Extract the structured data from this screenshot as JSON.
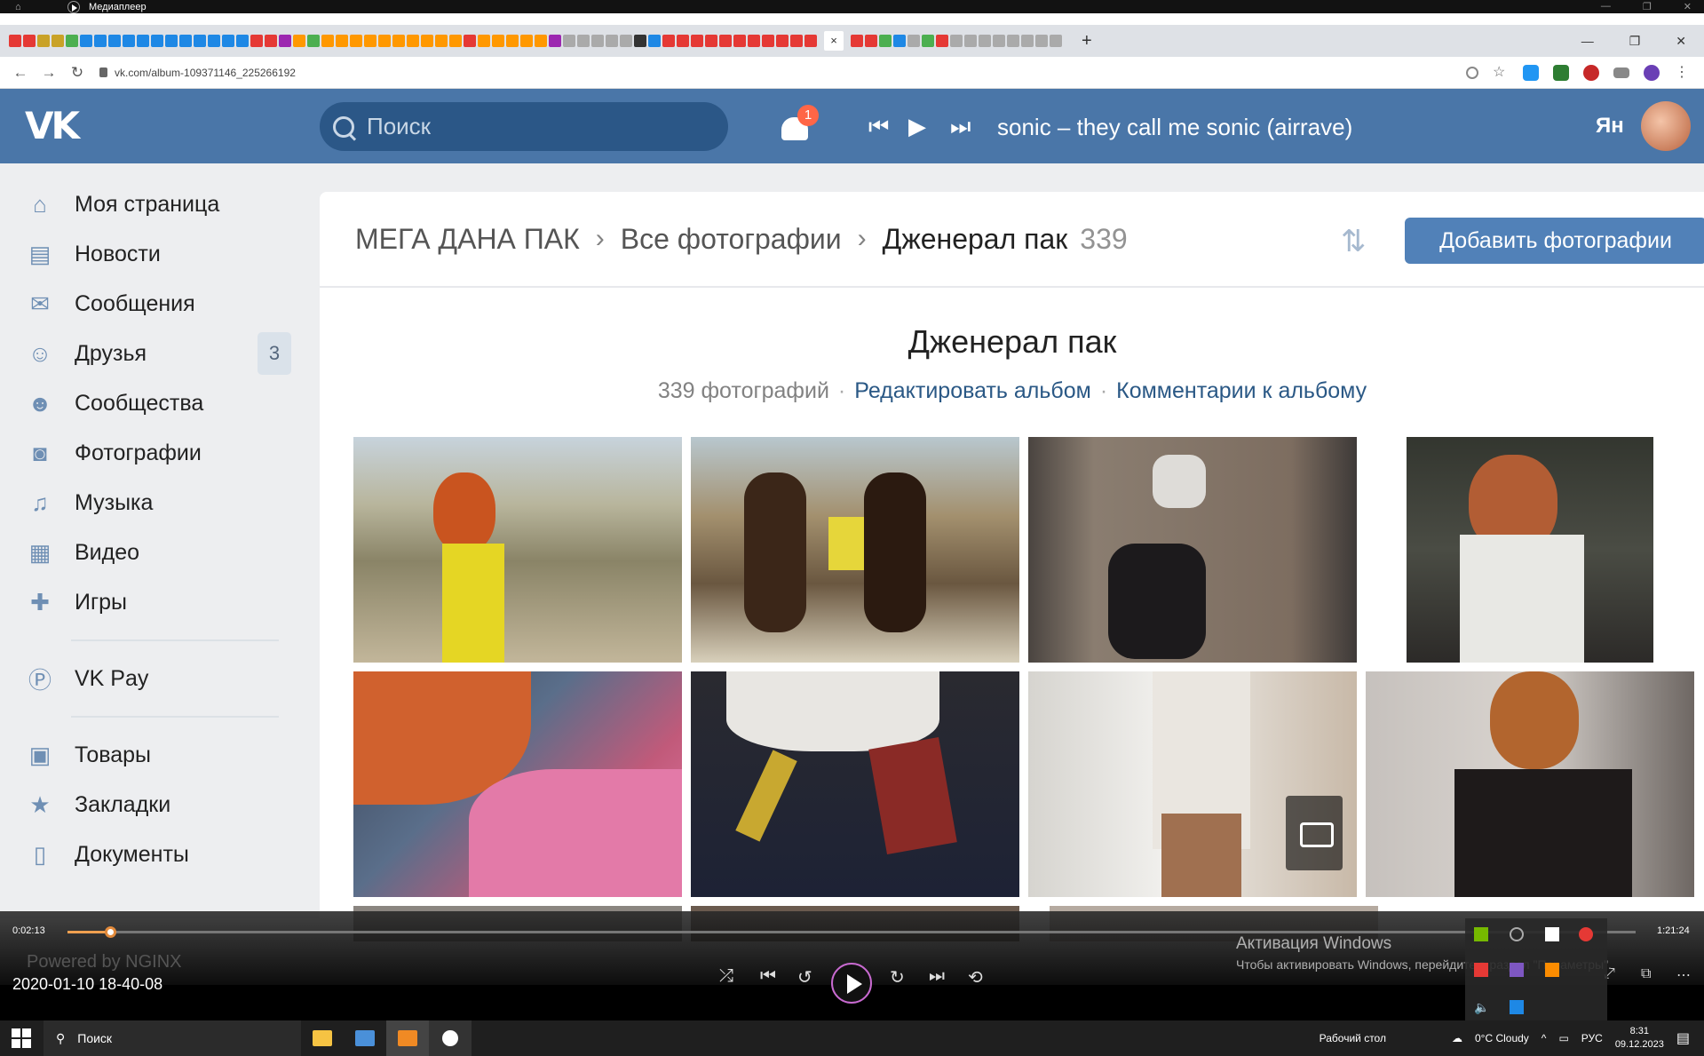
{
  "player": {
    "title": "Медиаплеер",
    "time_current": "0:02:13",
    "time_total": "1:21:24",
    "progress_fraction": 0.027,
    "file_name": "2020-01-10 18-40-08"
  },
  "browser": {
    "url": "vk.com/album-109371146_225266192"
  },
  "vk": {
    "search_placeholder": "Поиск",
    "notifications_count": "1",
    "now_playing": "sonic – they call me sonic (airrave)",
    "user_name": "Ян",
    "menu": [
      {
        "label": "Моя страница",
        "icon": "home-icon"
      },
      {
        "label": "Новости",
        "icon": "news-icon"
      },
      {
        "label": "Сообщения",
        "icon": "messages-icon"
      },
      {
        "label": "Друзья",
        "icon": "friends-icon",
        "count": "3"
      },
      {
        "label": "Сообщества",
        "icon": "groups-icon"
      },
      {
        "label": "Фотографии",
        "icon": "camera-icon"
      },
      {
        "label": "Музыка",
        "icon": "music-icon"
      },
      {
        "label": "Видео",
        "icon": "video-icon"
      },
      {
        "label": "Игры",
        "icon": "games-icon"
      },
      {
        "label": "VK Pay",
        "icon": "vkpay-icon"
      },
      {
        "label": "Товары",
        "icon": "bag-icon"
      },
      {
        "label": "Закладки",
        "icon": "star-icon"
      },
      {
        "label": "Документы",
        "icon": "document-icon"
      }
    ],
    "breadcrumb": {
      "level1": "МЕГА ДАНА ПАК",
      "level2": "Все фотографии",
      "current": "Дженерал пак",
      "count": "339"
    },
    "add_photos_label": "Добавить фотографии",
    "album": {
      "title": "Дженерал пак",
      "photo_count_text": "339 фотографий",
      "edit_link": "Редактировать альбом",
      "comments_link": "Комментарии к альбому"
    }
  },
  "overlay": {
    "powered_by": "Powered by NGINX",
    "activation_title": "Активация Windows",
    "activation_text": "Чтобы активировать Windows, перейдите в раздел \"Параметры\"."
  },
  "taskbar": {
    "search_label": "Поиск",
    "desktop_label": "Рабочий стол",
    "weather": "0°C  Cloudy",
    "lang": "РУС",
    "time": "8:31",
    "date": "09.12.2023"
  },
  "colors": {
    "vk_header": "#4a76a8",
    "vk_button": "#5181b8",
    "link": "#2a5885",
    "notification_badge": "#ff6647",
    "progress_accent": "#e28a3b"
  }
}
